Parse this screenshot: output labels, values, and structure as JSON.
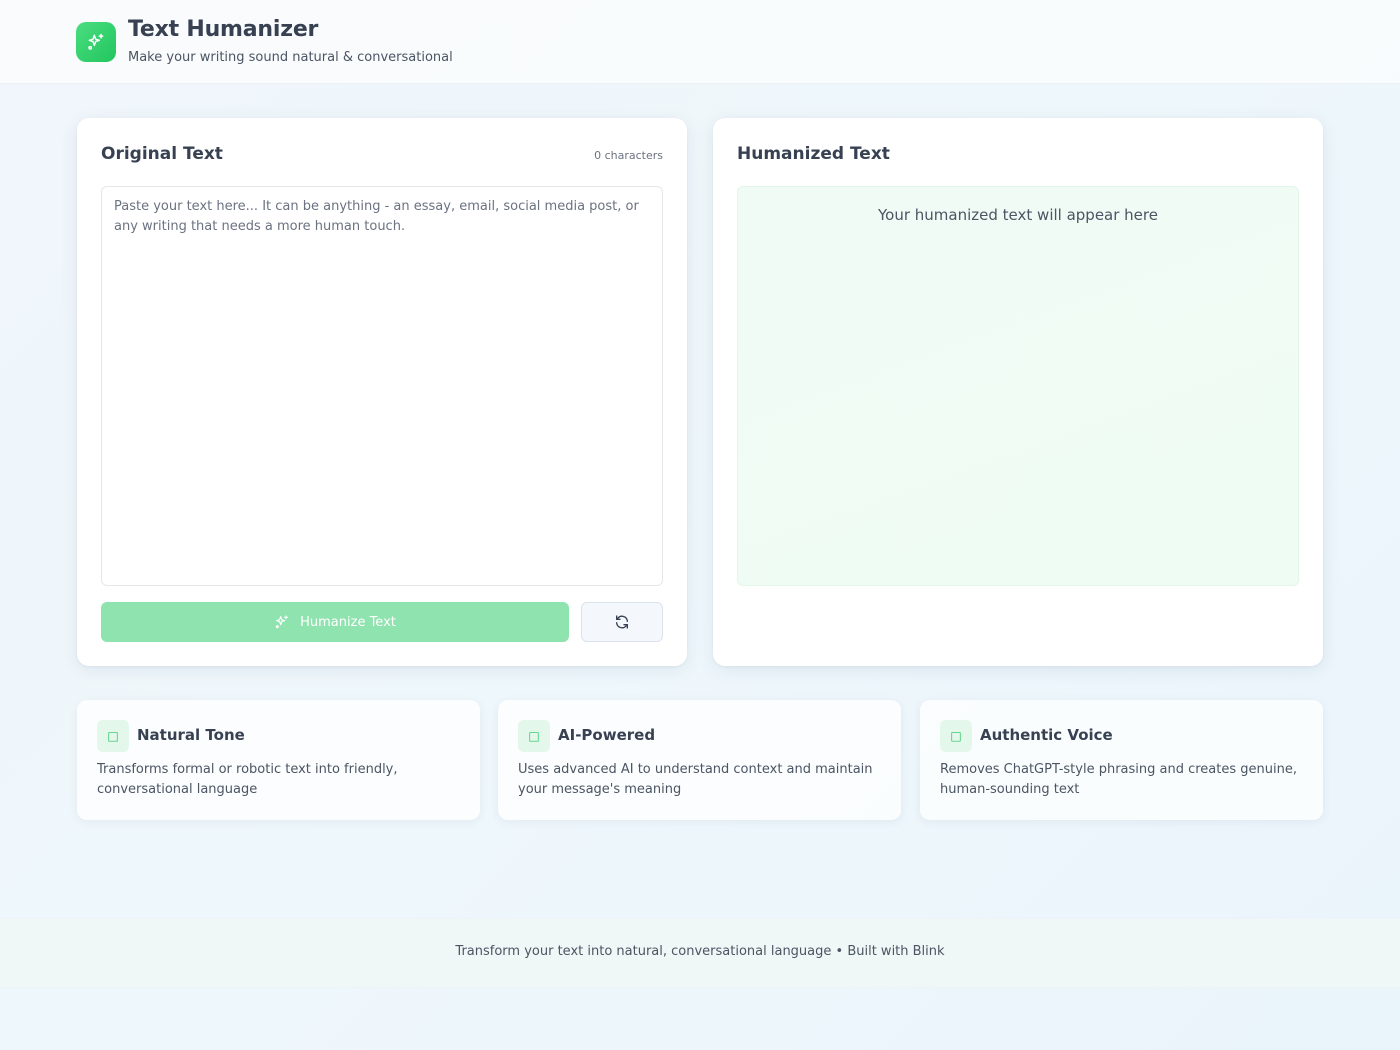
{
  "header": {
    "title": "Text Humanizer",
    "subtitle": "Make your writing sound natural & conversational",
    "logo_icon": "sparkles-icon"
  },
  "input_panel": {
    "title": "Original Text",
    "char_count": "0 characters",
    "placeholder": "Paste your text here... It can be anything - an essay, email, social media post, or any writing that needs a more human touch.",
    "value": "",
    "humanize_button_label": "Humanize Text",
    "humanize_button_icon": "sparkles-icon",
    "reset_button_icon": "refresh-icon"
  },
  "output_panel": {
    "title": "Humanized Text",
    "placeholder": "Your humanized text will appear here"
  },
  "features": [
    {
      "icon": "message-icon",
      "title": "Natural Tone",
      "description": "Transforms formal or robotic text into friendly, conversational language"
    },
    {
      "icon": "sparkles-icon",
      "title": "AI-Powered",
      "description": "Uses advanced AI to understand context and maintain your message's meaning"
    },
    {
      "icon": "user-icon",
      "title": "Authentic Voice",
      "description": "Removes ChatGPT-style phrasing and creates genuine, human-sounding text"
    }
  ],
  "footer": {
    "text": "Transform your text into natural, conversational language • Built with Blink"
  },
  "colors": {
    "accent": "#22c55e",
    "button_disabled": "#8ee3ae",
    "output_bg": "#effcf4"
  }
}
